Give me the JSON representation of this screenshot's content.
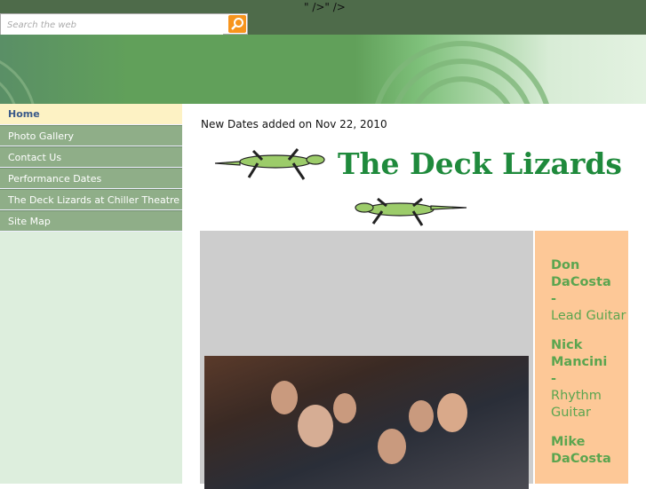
{
  "header": {
    "stray_text": "\" />\" />",
    "search_placeholder": "Search the web"
  },
  "nav": [
    {
      "label": "Home",
      "active": true
    },
    {
      "label": "Photo Gallery"
    },
    {
      "label": "Contact Us"
    },
    {
      "label": "Performance Dates"
    },
    {
      "label": "The Deck Lizards at Chiller Theatre"
    },
    {
      "label": "Site Map"
    }
  ],
  "main": {
    "news": "New Dates added on Nov 22, 2010",
    "logo_text": "The Deck Lizards",
    "members": [
      {
        "name": "Don DaCosta",
        "sep": "-",
        "role": "Lead Guitar"
      },
      {
        "name": "Nick Mancini",
        "sep": "-",
        "role": "Rhythm Guitar"
      },
      {
        "name": "Mike DaCosta"
      }
    ]
  },
  "colors": {
    "accent": "#f7941d",
    "nav": "#8fae88",
    "green": "#5ba54f",
    "panel": "#fdc897"
  }
}
